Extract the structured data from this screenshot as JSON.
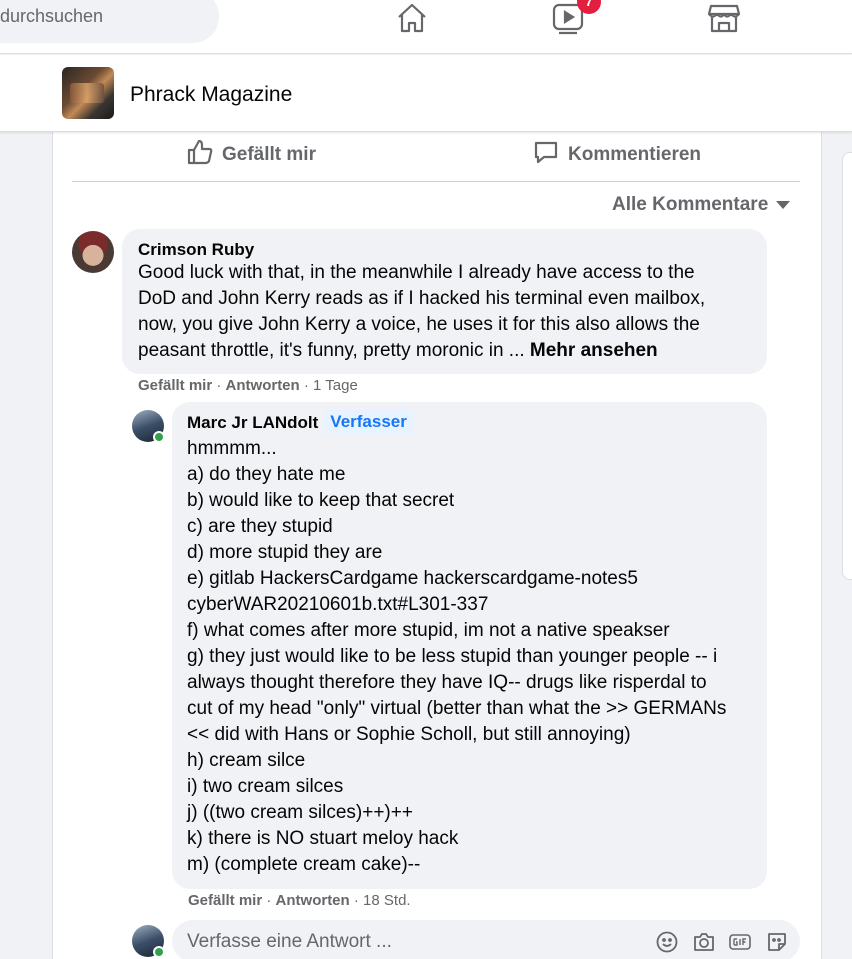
{
  "topnav": {
    "search_placeholder": "durchsuchen",
    "icons": [
      "home-icon",
      "watch-icon",
      "marketplace-icon"
    ],
    "watch_badge": "7"
  },
  "page": {
    "name": "Phrack Magazine"
  },
  "post_actions": {
    "like": "Gefällt mir",
    "comment": "Kommentieren"
  },
  "comment_filter": "Alle Kommentare",
  "comments": [
    {
      "author": "Crimson Ruby",
      "lines": [
        "Good luck with that, in the meanwhile I already have access to the",
        "DoD and John Kerry reads as if I hacked his terminal even mailbox,",
        "now, you give John Kerry a voice, he uses it for this also allows the",
        "peasant throttle, it's funny, pretty moronic in ..."
      ],
      "see_more": "Mehr ansehen",
      "like": "Gefällt mir",
      "reply": "Antworten",
      "time": "1 Tage"
    },
    {
      "author": "Marc Jr LANdolt",
      "badge": "Verfasser",
      "lines": [
        "hmmmm...",
        "a) do they hate me",
        "b) would like to keep that secret",
        "c) are they stupid",
        "d) more stupid they are",
        "e) gitlab HackersCardgame hackerscardgame-notes5",
        "cyberWAR20210601b.txt#L301-337",
        "f) what comes after more stupid, im not a native speakser",
        "g) they just would like to be less stupid than younger people -- i",
        "always thought therefore they have IQ-- drugs like risperdal to",
        "cut of my head \"only\" virtual (better than what the >> GERMANs",
        "<< did with Hans or Sophie Scholl, but still annoying)",
        "h) cream silce",
        "i) two cream silces",
        "j) ((two cream silces)++)++",
        "k) there is NO stuart meloy hack",
        "m) (complete cream cake)--"
      ],
      "like": "Gefällt mir",
      "reply": "Antworten",
      "time": "18 Std."
    }
  ],
  "reply_composer": {
    "placeholder": "Verfasse eine Antwort ...",
    "tools": [
      "emoji-icon",
      "camera-icon",
      "gif-icon",
      "sticker-icon"
    ]
  },
  "colors": {
    "accent": "#1877f2",
    "badge_red": "#e41e3f",
    "online": "#31a24c"
  }
}
